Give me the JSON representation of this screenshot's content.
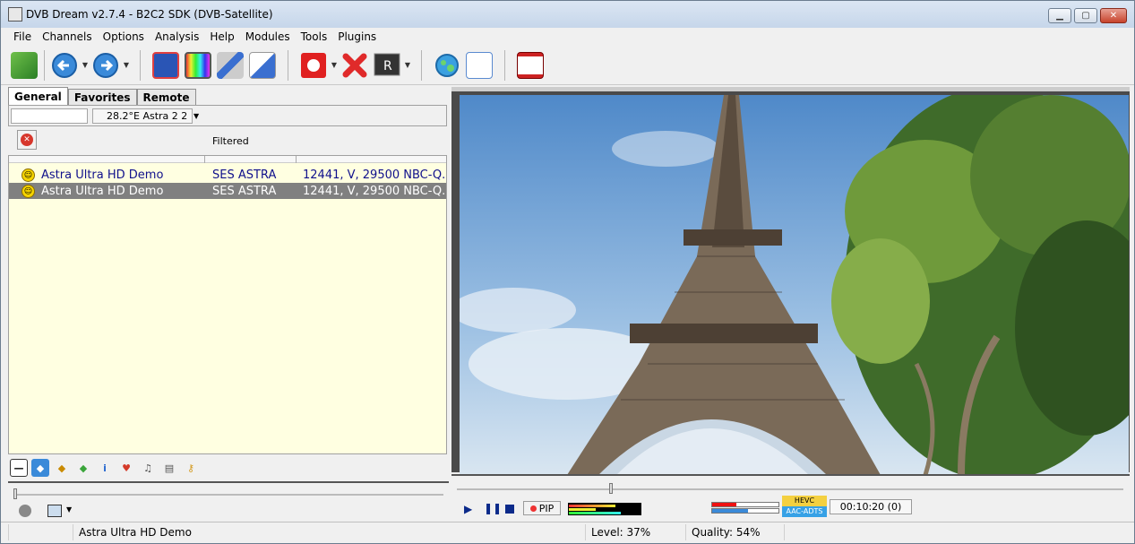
{
  "window": {
    "title": "DVB Dream v2.7.4 - B2C2 SDK (DVB-Satellite)",
    "minimize": "▁",
    "maximize": "▢",
    "close": "✕"
  },
  "menu": [
    "File",
    "Channels",
    "Options",
    "Analysis",
    "Help",
    "Modules",
    "Tools",
    "Plugins"
  ],
  "toolbar": {
    "icons": [
      "channel-list-icon",
      "back-icon",
      "forward-icon",
      "fullscreen-icon",
      "tv-screen-icon",
      "tools-icon",
      "checklist-icon",
      "record-icon",
      "stop-record-icon",
      "recorder-icon",
      "globe-icon",
      "epg-icon",
      "teletext-icon"
    ],
    "colors": {
      "back": "#3a8ad9",
      "record": "#e02020",
      "stop": "#e02a2a"
    }
  },
  "left_panel": {
    "tabs": [
      "General",
      "Favorites",
      "Remote"
    ],
    "active_tab": "General",
    "search_value": "",
    "satellite": "28.2°E Astra 2 2",
    "filter_label": "Filtered",
    "channels": [
      {
        "name": "Astra Ultra HD Demo",
        "provider": "SES ASTRA",
        "freq": "12441, V, 29500 NBC-Q...",
        "selected": false
      },
      {
        "name": "Astra Ultra HD Demo",
        "provider": "SES ASTRA",
        "freq": "12441, V, 29500 NBC-Q...",
        "selected": true
      }
    ],
    "list_bg": "#ffffe1"
  },
  "player": {
    "pip_label": "PIP",
    "video_codec": "HEVC",
    "audio_codec": "AAC-ADTS",
    "time": "00:10:20  (0)"
  },
  "status": {
    "channel": "Astra Ultra HD Demo",
    "level": "Level: 37%",
    "quality": "Quality: 54%",
    "level_value": 37,
    "quality_value": 54
  }
}
